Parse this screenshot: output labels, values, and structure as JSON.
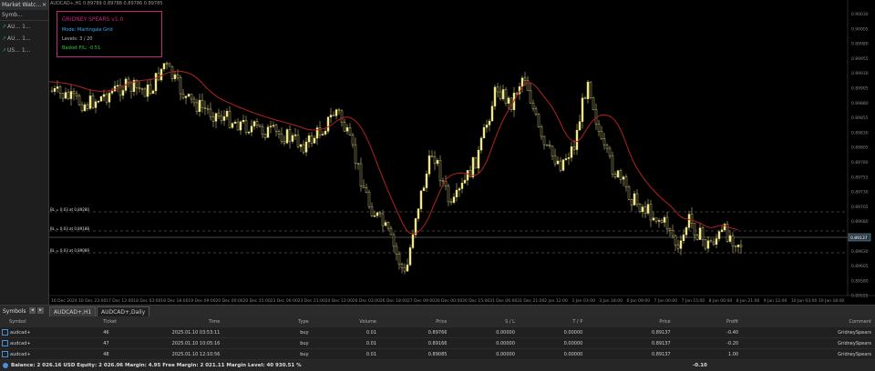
{
  "market_watch": {
    "title": "Market Watc...",
    "header": "Symb...",
    "rows": [
      {
        "symbol": "AU...",
        "value": "1..."
      },
      {
        "symbol": "AU...",
        "value": "1..."
      },
      {
        "symbol": "US...",
        "value": "1..."
      }
    ]
  },
  "chart": {
    "title": "AUDCAD+,H1  0.89789 0.89788 0.89786 0.89785",
    "panel": {
      "title": "GRIDNEY SPEARS v1.0",
      "mode": "Mode: Martingale Grid",
      "levels": "Levels: 3 / 20",
      "basket": "Basket P/L: -0.51"
    },
    "level_labels": [
      "BL = 0.03 at 0.89280",
      "BL = 0.03 at 0.89188",
      "BL = 0.03 at 0.89089"
    ],
    "current_price_label": "0.89137",
    "price_axis": [
      "0.90030",
      "0.90005",
      "0.89980",
      "0.89955",
      "0.89930",
      "0.89905",
      "0.89880",
      "0.89855",
      "0.89830",
      "0.89805",
      "0.89780",
      "0.89755",
      "0.89730",
      "0.89705",
      "0.89680",
      "0.89655",
      "0.89630",
      "0.89605",
      "0.89580",
      "0.89555"
    ],
    "time_axis": [
      "16 Dec 2024",
      "16 Dec 23:00",
      "17 Dec 12:00",
      "18 Dec 03:00",
      "18 Dec 18:00",
      "19 Dec 09:00",
      "20 Dec 00:00",
      "20 Dec 15:00",
      "23 Dec 06:00",
      "23 Dec 21:00",
      "24 Dec 12:00",
      "26 Dec 03:00",
      "26 Dec 18:00",
      "27 Dec 09:00",
      "30 Dec 00:00",
      "30 Dec 15:00",
      "31 Dec 06:00",
      "31 Dec 21:00",
      "2 Jan 12:00",
      "3 Jan 03:00",
      "3 Jan 18:00",
      "6 Jan 09:00",
      "7 Jan 00:00",
      "7 Jan 15:00",
      "8 Jan 06:00",
      "8 Jan 21:00",
      "9 Jan 12:00",
      "10 Jan 03:00",
      "10 Jan 18:00"
    ],
    "colors": {
      "candle": "#f0e68c",
      "ma": "#b22222",
      "panel_border": "#c0287a"
    }
  },
  "tabs": {
    "symbols": "Symbols",
    "nav_prev": "◂",
    "nav_next": "▸",
    "items": [
      "AUDCAD+,H1",
      "AUDCAD+,Daily"
    ]
  },
  "trade_table": {
    "headers": [
      "Symbol",
      "Ticket",
      "Time",
      "Type",
      "Volume",
      "Price",
      "S / L",
      "T / P",
      "Price",
      "Profit",
      "Comment"
    ],
    "rows": [
      [
        "audcad+",
        "46",
        "2025.01.10 03:53:11",
        "buy",
        "0.01",
        "0.89766",
        "0.00000",
        "0.00000",
        "0.89137",
        "-0.40",
        "GridneySpears"
      ],
      [
        "audcad+",
        "47",
        "2025.01.10 10:05:16",
        "buy",
        "0.01",
        "0.89166",
        "0.00000",
        "0.00000",
        "0.89137",
        "-0.20",
        "GridneySpears"
      ],
      [
        "audcad+",
        "48",
        "2025.01.10 12:10:56",
        "buy",
        "0.01",
        "0.89085",
        "0.00000",
        "0.00000",
        "0.89137",
        "1.00",
        "GridneySpears"
      ]
    ],
    "balance": "Balance: 2 026.16 USD  Equity: 2 026.06  Margin: 4.95  Free Margin: 2 021.11  Margin Level: 40 930.51 %",
    "total_profit": "-0.10"
  }
}
